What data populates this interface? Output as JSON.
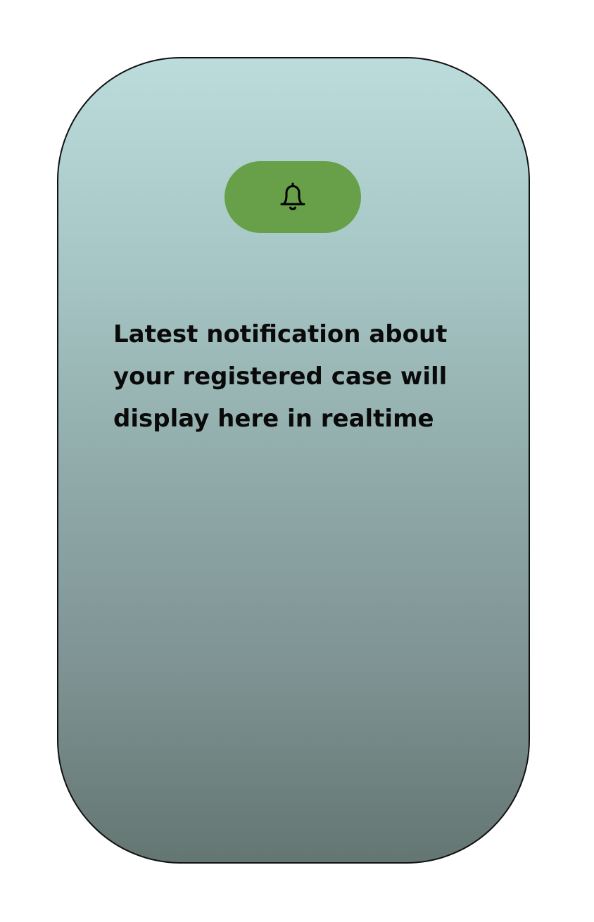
{
  "notification_card": {
    "icon": "bell-icon",
    "message": "Latest notification about your registered case will display here in realtime"
  },
  "colors": {
    "pill": "#67a048",
    "gradient_top": "#bcdcdc",
    "gradient_bottom": "#647672",
    "text": "#0a0a0a"
  }
}
